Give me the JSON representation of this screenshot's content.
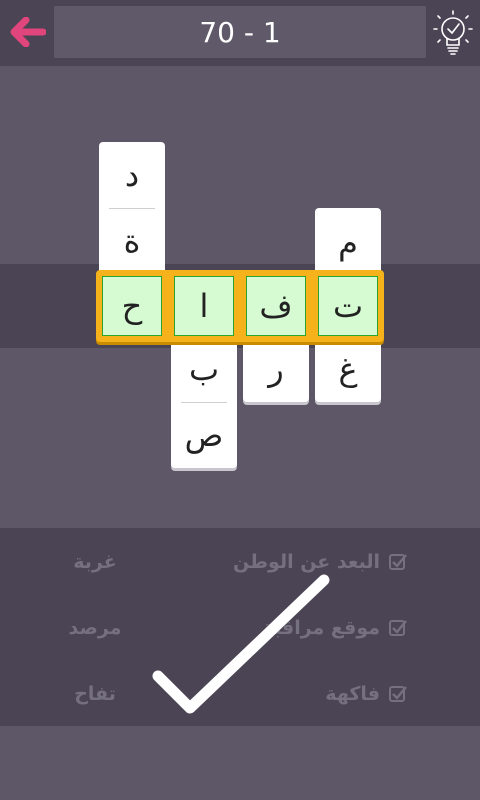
{
  "header": {
    "level_title": "70 - 1",
    "back_icon": "arrow-left-icon",
    "hint_icon": "lightbulb-check-icon",
    "accent_color": "#e0457b"
  },
  "board": {
    "highlight_word": [
      "ح",
      "ا",
      "ف",
      "ت"
    ],
    "col1_above": [
      "د",
      "ة"
    ],
    "col2_below": [
      "ب",
      "ص"
    ],
    "col3_below": [
      "ر"
    ],
    "col4_above": [
      "م"
    ],
    "col4_below": [
      "غ"
    ]
  },
  "clues": [
    {
      "clue": "البعد عن الوطن",
      "answer": "غربة",
      "solved": true
    },
    {
      "clue": "موقع مراقبة",
      "answer": "مرصد",
      "solved": true
    },
    {
      "clue": "فاكهة",
      "answer": "تفاح",
      "solved": true
    }
  ],
  "completion_icon": "big-checkmark-icon"
}
